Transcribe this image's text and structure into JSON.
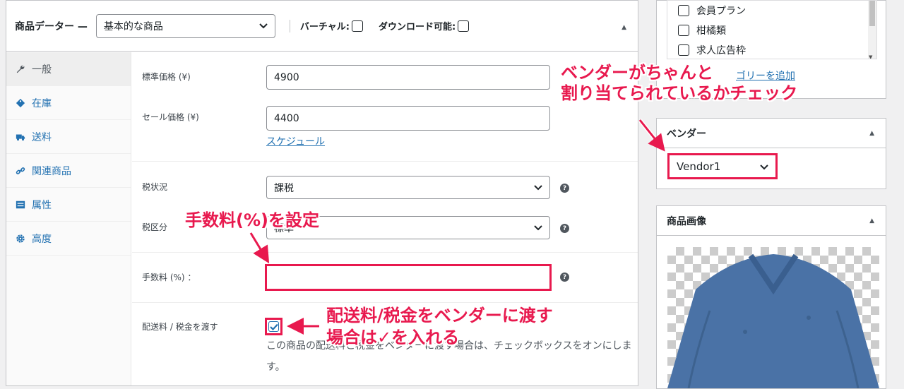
{
  "product_data": {
    "title": "商品データー —",
    "product_type": "基本的な商品",
    "virtual_label": "バーチャル:",
    "downloadable_label": "ダウンロード可能:",
    "tabs": [
      {
        "label": "一般",
        "icon": "wrench-icon"
      },
      {
        "label": "在庫",
        "icon": "tag-icon"
      },
      {
        "label": "送料",
        "icon": "truck-icon"
      },
      {
        "label": "関連商品",
        "icon": "link-icon"
      },
      {
        "label": "属性",
        "icon": "list-icon"
      },
      {
        "label": "高度",
        "icon": "gear-icon"
      }
    ],
    "regular_price_label": "標準価格 (¥)",
    "regular_price": "4900",
    "sale_price_label": "セール価格 (¥)",
    "sale_price": "4400",
    "schedule_link": "スケジュール",
    "tax_status_label": "税状況",
    "tax_status": "課税",
    "tax_class_label": "税区分",
    "tax_class": "標準",
    "fee_label": "手数料 (%) ：",
    "fee_value": "",
    "pass_shipping_label": "配送料 / 税金を渡す",
    "pass_shipping_checked": true,
    "pass_shipping_desc": "この商品の配送料と税金をベンダーに渡す場合は、チェックボックスをオンにします。"
  },
  "categories": {
    "items": [
      "会員プラン",
      "柑橘類",
      "求人広告枠"
    ],
    "add_link": "ゴリーを追加"
  },
  "vendor": {
    "title": "ベンダー",
    "selected": "Vendor1"
  },
  "product_image": {
    "title": "商品画像"
  },
  "annotations": {
    "vendor_line1": "ベンダーがちゃんと",
    "vendor_line2": "割り当てられているかチェック",
    "fee": "手数料(%)を設定",
    "shipping_line1": "配送料/税金をベンダーに渡す",
    "shipping_line2": "場合は✓を入れる"
  },
  "colors": {
    "accent": "#e8194e",
    "link": "#2271b1"
  }
}
